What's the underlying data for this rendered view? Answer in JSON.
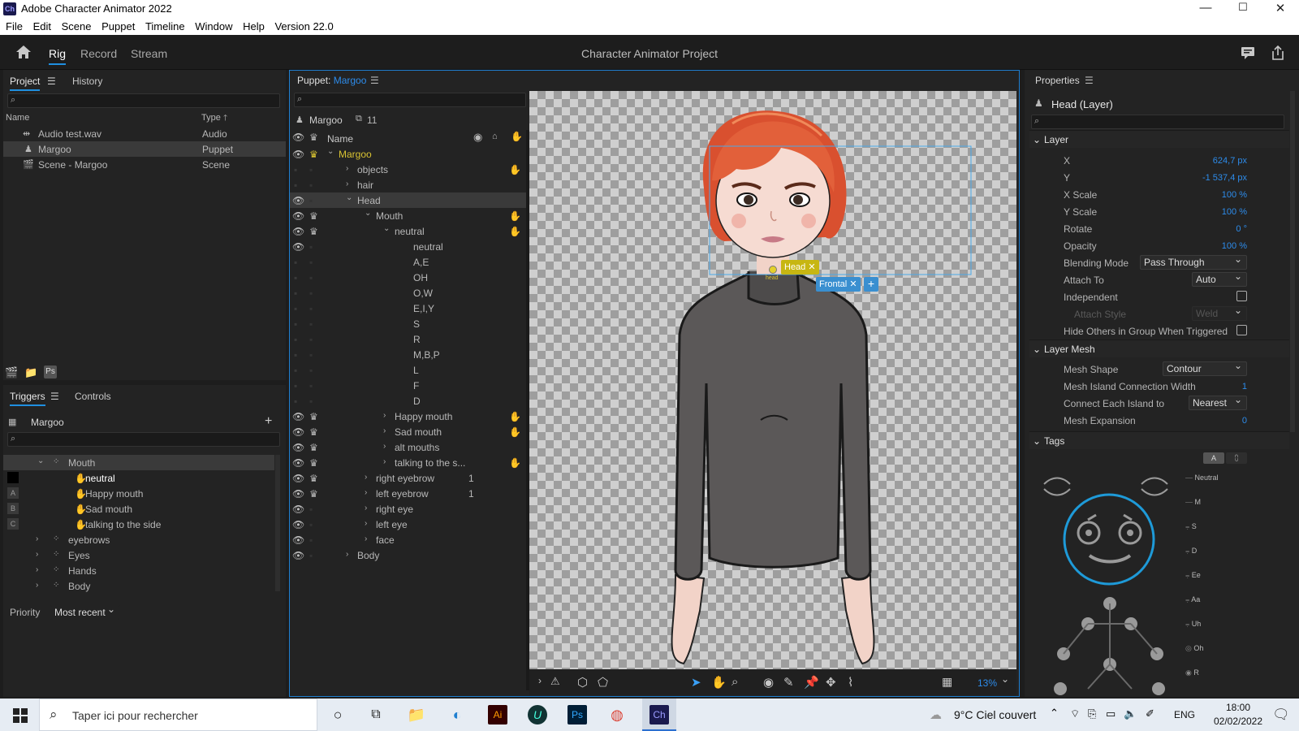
{
  "window": {
    "app_icon": "Ch",
    "title": "Adobe Character Animator 2022",
    "minimize": "—",
    "maximize": "☐",
    "close": "✕"
  },
  "menu": [
    "File",
    "Edit",
    "Scene",
    "Puppet",
    "Timeline",
    "Window",
    "Help",
    "Version 22.0"
  ],
  "workspace": {
    "tabs": [
      "Rig",
      "Record",
      "Stream"
    ],
    "active": "Rig",
    "project_title": "Character Animator Project"
  },
  "project_panel": {
    "tabs": [
      "Project",
      "History"
    ],
    "col_name": "Name",
    "col_type": "Type",
    "items": [
      {
        "name": "Audio test.wav",
        "type": "Audio"
      },
      {
        "name": "Margoo",
        "type": "Puppet"
      },
      {
        "name": "Scene - Margoo",
        "type": "Scene"
      }
    ],
    "footer_ps": "Ps"
  },
  "triggers_panel": {
    "tabs": [
      "Triggers",
      "Controls"
    ],
    "puppet_name": "Margoo",
    "add": "+",
    "group_name": "Mouth",
    "triggers": [
      {
        "key": "",
        "name": "neutral"
      },
      {
        "key": "A",
        "name": "Happy mouth"
      },
      {
        "key": "B",
        "name": "Sad mouth"
      },
      {
        "key": "C",
        "name": "talking to the side"
      }
    ],
    "groups": [
      "eyebrows",
      "Eyes",
      "Hands",
      "Body"
    ],
    "priority_label": "Priority",
    "priority_value": "Most recent"
  },
  "puppet_panel": {
    "title_prefix": "Puppet:",
    "puppet_name": "Margoo",
    "layer_root_name": "Margoo",
    "layer_count": "11",
    "col_name": "Name",
    "rows": [
      {
        "name": "Margoo",
        "indent": 0,
        "expanded": true,
        "eye": true,
        "crown": true,
        "yellow": true
      },
      {
        "name": "objects",
        "indent": 1,
        "expanded": false,
        "eye": false,
        "crown": false,
        "hand": true
      },
      {
        "name": "hair",
        "indent": 1,
        "expanded": false,
        "eye": false,
        "crown": false
      },
      {
        "name": "Head",
        "indent": 1,
        "expanded": true,
        "eye": true,
        "crown": false,
        "selected": true
      },
      {
        "name": "Mouth",
        "indent": 2,
        "expanded": true,
        "eye": true,
        "crown": true,
        "hand": true
      },
      {
        "name": "neutral",
        "indent": 3,
        "expanded": true,
        "eye": true,
        "crown": true,
        "hand": true
      },
      {
        "name": "neutral",
        "indent": 4,
        "eye": true,
        "crown": false
      },
      {
        "name": "A,E",
        "indent": 4,
        "eye": false,
        "crown": false
      },
      {
        "name": "OH",
        "indent": 4,
        "eye": false,
        "crown": false
      },
      {
        "name": "O,W",
        "indent": 4,
        "eye": false,
        "crown": false
      },
      {
        "name": "E,I,Y",
        "indent": 4,
        "eye": false,
        "crown": false
      },
      {
        "name": "S",
        "indent": 4,
        "eye": false,
        "crown": false
      },
      {
        "name": "R",
        "indent": 4,
        "eye": false,
        "crown": false
      },
      {
        "name": "M,B,P",
        "indent": 4,
        "eye": false,
        "crown": false
      },
      {
        "name": "L",
        "indent": 4,
        "eye": false,
        "crown": false
      },
      {
        "name": "F",
        "indent": 4,
        "eye": false,
        "crown": false
      },
      {
        "name": "D",
        "indent": 4,
        "eye": false,
        "crown": false
      },
      {
        "name": "Happy mouth",
        "indent": 3,
        "expanded": false,
        "eye": true,
        "crown": true,
        "hand": true
      },
      {
        "name": "Sad mouth",
        "indent": 3,
        "expanded": false,
        "eye": true,
        "crown": true,
        "hand": true
      },
      {
        "name": "alt mouths",
        "indent": 3,
        "expanded": false,
        "eye": true,
        "crown": true
      },
      {
        "name": "talking to the s...",
        "indent": 3,
        "expanded": false,
        "eye": true,
        "crown": true,
        "hand": true
      },
      {
        "name": "right eyebrow",
        "indent": 2,
        "expanded": false,
        "eye": true,
        "crown": true,
        "num": "1"
      },
      {
        "name": "left eyebrow",
        "indent": 2,
        "expanded": false,
        "eye": true,
        "crown": true,
        "num": "1"
      },
      {
        "name": "right eye",
        "indent": 2,
        "expanded": false,
        "eye": true,
        "crown": false
      },
      {
        "name": "left eye",
        "indent": 2,
        "expanded": false,
        "eye": true,
        "crown": false
      },
      {
        "name": "face",
        "indent": 2,
        "expanded": false,
        "eye": true,
        "crown": false
      },
      {
        "name": "Body",
        "indent": 1,
        "expanded": false,
        "eye": true,
        "crown": false
      }
    ]
  },
  "canvas": {
    "handle_label": "Head",
    "handle_small": "head",
    "frontal_tag": "Frontal",
    "zoom": "13%"
  },
  "properties_panel": {
    "title": "Properties",
    "selection": "Head (Layer)",
    "layer_section": "Layer",
    "props": [
      {
        "label": "X",
        "value": "624,7 px"
      },
      {
        "label": "Y",
        "value": "-1 537,4 px"
      },
      {
        "label": "X Scale",
        "value": "100 %"
      },
      {
        "label": "Y Scale",
        "value": "100 %"
      },
      {
        "label": "Rotate",
        "value": "0 °"
      },
      {
        "label": "Opacity",
        "value": "100 %"
      }
    ],
    "blending_label": "Blending Mode",
    "blending_value": "Pass Through",
    "attach_label": "Attach To",
    "attach_value": "Auto",
    "independent_label": "Independent",
    "attach_style_label": "Attach Style",
    "attach_style_value": "Weld",
    "hide_others_label": "Hide Others in Group When Triggered",
    "mesh_section": "Layer Mesh",
    "mesh_shape_label": "Mesh Shape",
    "mesh_shape_value": "Contour",
    "island_width_label": "Mesh Island Connection Width",
    "island_width_value": "1",
    "connect_label": "Connect Each Island to",
    "connect_value": "Nearest",
    "expansion_label": "Mesh Expansion",
    "expansion_value": "0",
    "tags_section": "Tags",
    "tags_toggle": "A",
    "mouth_tags": [
      "Neutral",
      "M",
      "S",
      "D",
      "Ee",
      "Aa",
      "Uh",
      "Oh",
      "R"
    ]
  },
  "taskbar": {
    "search_placeholder": "Taper ici pour rechercher",
    "weather": "9°C  Ciel couvert",
    "lang": "ENG",
    "time": "18:00",
    "date": "02/02/2022",
    "ai_label": "Ai",
    "ps_label": "Ps",
    "ch_label": "Ch"
  },
  "colors": {
    "accent": "#1f8fe0",
    "value_blue": "#2d8ceb",
    "handle_yellow": "#c7b612",
    "frontal_blue": "#3a8fd0",
    "yellow_text": "#d9c332"
  }
}
